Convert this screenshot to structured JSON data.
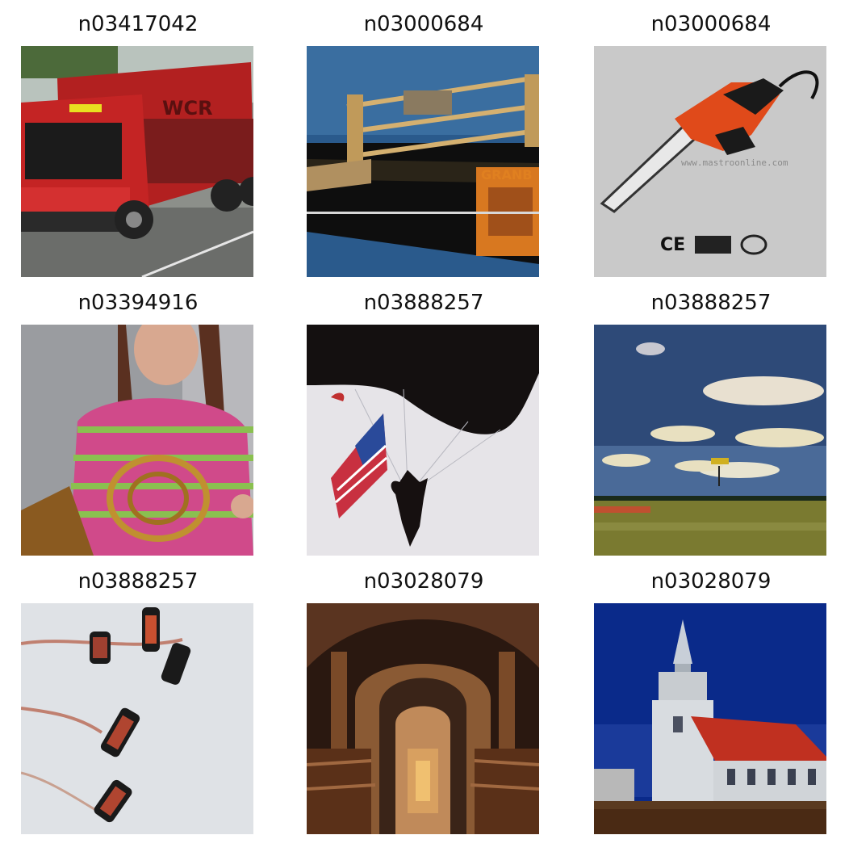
{
  "grid": {
    "cells": [
      {
        "label": "n03417042",
        "subject": "garbage-truck"
      },
      {
        "label": "n03000684",
        "subject": "chain-saw-machine"
      },
      {
        "label": "n03000684",
        "subject": "chain-saw-product"
      },
      {
        "label": "n03394916",
        "subject": "french-horn-girl"
      },
      {
        "label": "n03888257",
        "subject": "parachute-flag"
      },
      {
        "label": "n03888257",
        "subject": "parachute-sky"
      },
      {
        "label": "n03888257",
        "subject": "parachute-formation"
      },
      {
        "label": "n03028079",
        "subject": "church-interior"
      },
      {
        "label": "n03028079",
        "subject": "church-exterior"
      }
    ]
  },
  "visible_text": {
    "chainsaw_watermark": "www.mastroonline.com",
    "chainsaw_marks": "CE"
  }
}
